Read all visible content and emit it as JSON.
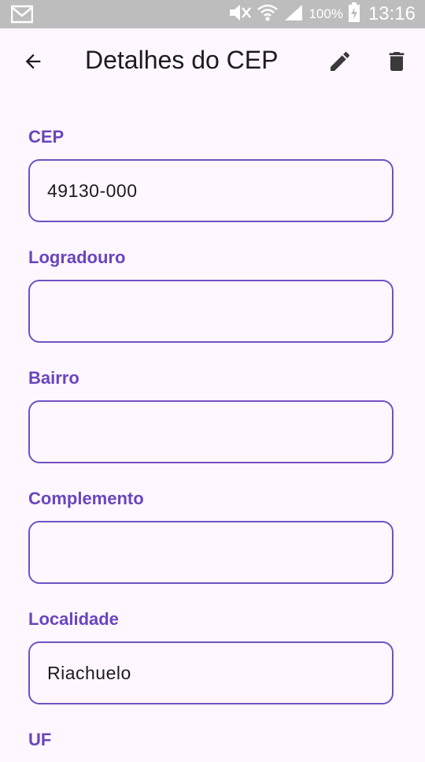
{
  "status_bar": {
    "battery_percent": "100%",
    "time": "13:16",
    "icons": [
      "gmail-icon",
      "mute-icon",
      "wifi-icon",
      "signal-icon",
      "battery-charging-icon"
    ]
  },
  "app_bar": {
    "title": "Detalhes do CEP",
    "back_icon": "arrow-back-icon",
    "edit_icon": "edit-pencil-icon",
    "delete_icon": "trash-icon"
  },
  "form": {
    "fields": [
      {
        "label": "CEP",
        "value": "49130-000"
      },
      {
        "label": "Logradouro",
        "value": ""
      },
      {
        "label": "Bairro",
        "value": ""
      },
      {
        "label": "Complemento",
        "value": ""
      },
      {
        "label": "Localidade",
        "value": "Riachuelo"
      },
      {
        "label": "UF",
        "value": ""
      }
    ]
  },
  "colors": {
    "accent": "#6A45BE",
    "border": "#7251C2",
    "background": "#FEF7FF",
    "status_bar": "#BDBDBD"
  }
}
